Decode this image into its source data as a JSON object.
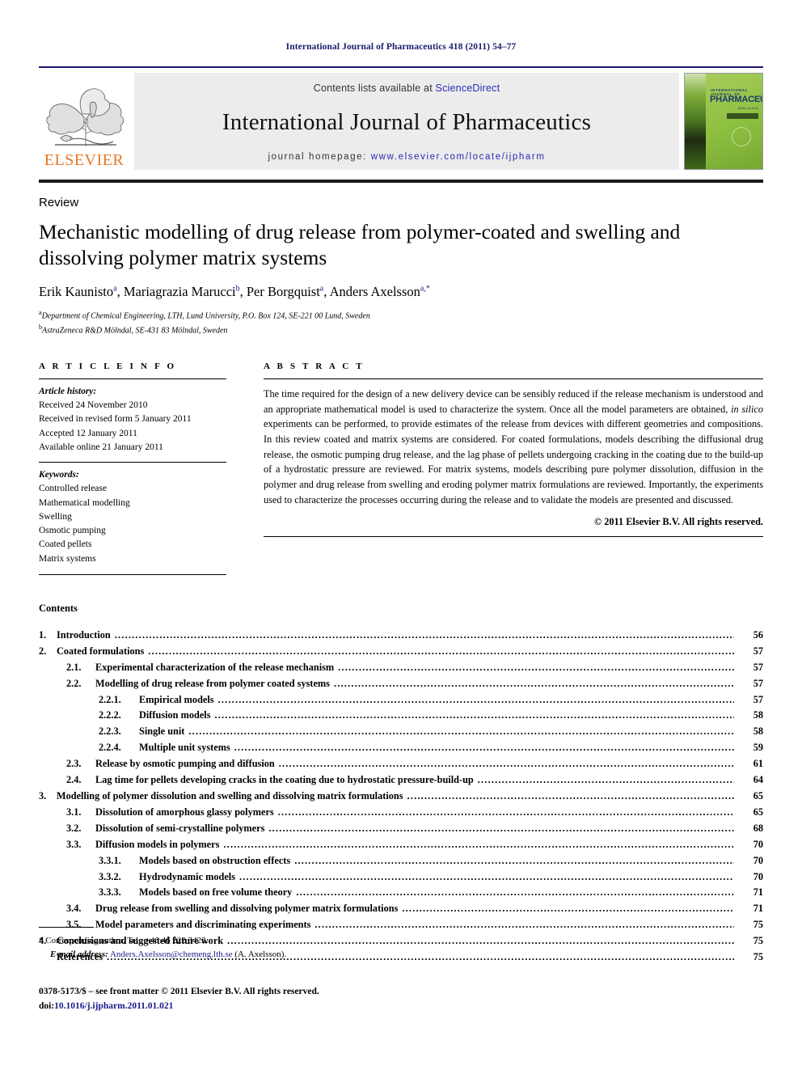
{
  "running_head": "International Journal of Pharmaceutics 418 (2011) 54–77",
  "masthead": {
    "publisher_name": "ELSEVIER",
    "contents_prefix": "Contents lists available at ",
    "sciencedirect": "ScienceDirect",
    "journal_title": "International Journal of Pharmaceutics",
    "homepage_prefix": "journal homepage: ",
    "homepage_url": "www.elsevier.com/locate/ijpharm",
    "cover": {
      "line1": "INTERNATIONAL JOURNAL OF",
      "line2": "PHARMACEUTICS",
      "line3": "Editor-in-chief"
    },
    "colors": {
      "link": "#2b2bb5",
      "elsevier_orange": "#e87722",
      "rule_navy": "#1a1a6e",
      "cover_green": "#8cbf3f"
    }
  },
  "article": {
    "doctype": "Review",
    "title": "Mechanistic modelling of drug release from polymer-coated and swelling and dissolving polymer matrix systems",
    "authors": "Erik Kaunisto a , Mariagrazia Marucci b , Per Borgquist a , Anders Axelsson a,*",
    "author_list": [
      {
        "name": "Erik Kaunisto",
        "sup": "a"
      },
      {
        "name": "Mariagrazia Marucci",
        "sup": "b"
      },
      {
        "name": "Per Borgquist",
        "sup": "a"
      },
      {
        "name": "Anders Axelsson",
        "sup": "a,*"
      }
    ],
    "affiliations": [
      {
        "sup": "a",
        "text": "Department of Chemical Engineering, LTH, Lund University, P.O. Box 124, SE-221 00 Lund, Sweden"
      },
      {
        "sup": "b",
        "text": "AstraZeneca R&D Mölndal, SE-431 83 Mölndal, Sweden"
      }
    ]
  },
  "article_info": {
    "heading": "A R T I C L E   I N F O",
    "history_label": "Article history:",
    "history": [
      "Received 24 November 2010",
      "Received in revised form 5 January 2011",
      "Accepted 12 January 2011",
      "Available online 21 January 2011"
    ],
    "keywords_label": "Keywords:",
    "keywords": [
      "Controlled release",
      "Mathematical modelling",
      "Swelling",
      "Osmotic pumping",
      "Coated pellets",
      "Matrix systems"
    ]
  },
  "abstract": {
    "heading": "A B S T R A C T",
    "text_part1": "The time required for the design of a new delivery device can be sensibly reduced if the release mechanism is understood and an appropriate mathematical model is used to characterize the system. Once all the model parameters are obtained, ",
    "italic1": "in silico",
    "text_part2": " experiments can be performed, to provide estimates of the release from devices with different geometries and compositions. In this review coated and matrix systems are considered. For coated formulations, models describing the diffusional drug release, the osmotic pumping drug release, and the lag phase of pellets undergoing cracking in the coating due to the build-up of a hydrostatic pressure are reviewed. For matrix systems, models describing pure polymer dissolution, diffusion in the polymer and drug release from swelling and eroding polymer matrix formulations are reviewed. Importantly, the experiments used to characterize the processes occurring during the release and to validate the models are presented and discussed.",
    "copyright": "© 2011 Elsevier B.V. All rights reserved."
  },
  "contents": {
    "heading": "Contents",
    "entries": [
      {
        "level": 1,
        "num": "1.",
        "label": "Introduction",
        "page": "56"
      },
      {
        "level": 1,
        "num": "2.",
        "label": "Coated formulations",
        "page": "57"
      },
      {
        "level": 2,
        "num": "2.1.",
        "label": "Experimental characterization of the release mechanism",
        "page": "57"
      },
      {
        "level": 2,
        "num": "2.2.",
        "label": "Modelling of drug release from polymer coated systems",
        "page": "57"
      },
      {
        "level": 3,
        "num": "2.2.1.",
        "label": "Empirical models",
        "page": "57"
      },
      {
        "level": 3,
        "num": "2.2.2.",
        "label": "Diffusion models",
        "page": "58"
      },
      {
        "level": 3,
        "num": "2.2.3.",
        "label": "Single unit",
        "page": "58"
      },
      {
        "level": 3,
        "num": "2.2.4.",
        "label": "Multiple unit systems",
        "page": "59"
      },
      {
        "level": 2,
        "num": "2.3.",
        "label": "Release by osmotic pumping and diffusion",
        "page": "61"
      },
      {
        "level": 2,
        "num": "2.4.",
        "label": "Lag time for pellets developing cracks in the coating due to hydrostatic pressure-build-up",
        "page": "64"
      },
      {
        "level": 1,
        "num": "3.",
        "label": "Modelling of polymer dissolution and swelling and dissolving matrix formulations",
        "page": "65"
      },
      {
        "level": 2,
        "num": "3.1.",
        "label": "Dissolution of amorphous glassy polymers",
        "page": "65"
      },
      {
        "level": 2,
        "num": "3.2.",
        "label": "Dissolution of semi-crystalline polymers",
        "page": "68"
      },
      {
        "level": 2,
        "num": "3.3.",
        "label": "Diffusion models in polymers",
        "page": "70"
      },
      {
        "level": 3,
        "num": "3.3.1.",
        "label": "Models based on obstruction effects",
        "page": "70"
      },
      {
        "level": 3,
        "num": "3.3.2.",
        "label": "Hydrodynamic models",
        "page": "70"
      },
      {
        "level": 3,
        "num": "3.3.3.",
        "label": "Models based on free volume theory",
        "page": "71"
      },
      {
        "level": 2,
        "num": "3.4.",
        "label": "Drug release from swelling and dissolving polymer matrix formulations",
        "page": "71"
      },
      {
        "level": 2,
        "num": "3.5.",
        "label": "Model parameters and discriminating experiments",
        "page": "75"
      },
      {
        "level": 1,
        "num": "4.",
        "label": "Conclusions and suggested future work",
        "page": "75"
      },
      {
        "level": 1,
        "num": "",
        "label": "References",
        "page": "75"
      }
    ]
  },
  "footnote": {
    "marker": "*",
    "corresponding": "Corresponding author. Tel.: +46 46 222 3423.",
    "email_label": "E-mail address:",
    "email": "Anders.Axelsson@chemeng.lth.se",
    "email_suffix": "(A. Axelsson)."
  },
  "imprint": {
    "line1": "0378-5173/$ – see front matter © 2011 Elsevier B.V. All rights reserved.",
    "doi_prefix": "doi:",
    "doi": "10.1016/j.ijpharm.2011.01.021"
  }
}
